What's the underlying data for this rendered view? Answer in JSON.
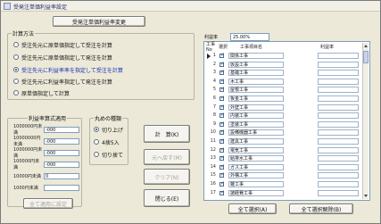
{
  "window": {
    "title": "受発注単価利益率設定"
  },
  "header_button": "受発注単価利益率変更",
  "calc_method": {
    "legend": "計算方法",
    "options": [
      {
        "label": "受注先元に原単価指定して受注を計算",
        "selected": false
      },
      {
        "label": "受注先元に原単価指定して発注を計算",
        "selected": false
      },
      {
        "label": "受注先元に利益率率を指定して受注を計算",
        "selected": true
      },
      {
        "label": "受注先元に利益率指定して発注を計算",
        "selected": false
      },
      {
        "label": "原単価指定して計算",
        "selected": false
      }
    ]
  },
  "rate_group": {
    "legend": "利益率算式適用",
    "rows": [
      {
        "label": "1000000円未満",
        "value": "-000"
      },
      {
        "label": "10000000円未満",
        "value": "-000"
      },
      {
        "label": "1000000円未満",
        "value": "-000"
      },
      {
        "label": "100000円未満",
        "value": "-000"
      },
      {
        "label": "10000円未満",
        "value": "0"
      },
      {
        "label": "1000円未満",
        "value": ""
      }
    ],
    "apply_button": "全て適用に設定"
  },
  "rounding": {
    "legend": "丸めの種類",
    "options": [
      {
        "label": "切り上げ",
        "selected": true
      },
      {
        "label": "4捨5入",
        "selected": false
      },
      {
        "label": "切り捨て",
        "selected": false
      }
    ]
  },
  "buttons": {
    "calc": "計　算(K)",
    "prev": "元へ戻す(M)",
    "clear": "クリア(N)",
    "close": "閉じる(E)",
    "all_select": "全て選択(A)",
    "all_deselect": "全て選択解除(B)"
  },
  "rate_field": {
    "label": "利益率",
    "value": "25.00%"
  },
  "list": {
    "headers": {
      "no": "工事No",
      "check": "選択",
      "name": "工事項目名",
      "rate": "利益率"
    },
    "rows": [
      {
        "no": "1",
        "checked": true,
        "name": "関係工事"
      },
      {
        "no": "2",
        "checked": true,
        "name": "仮設工事"
      },
      {
        "no": "3",
        "checked": true,
        "name": "基礎工事"
      },
      {
        "no": "4",
        "checked": true,
        "name": "木工事"
      },
      {
        "no": "5",
        "checked": true,
        "name": "屋根工事"
      },
      {
        "no": "6",
        "checked": true,
        "name": "板金工事"
      },
      {
        "no": "7",
        "checked": true,
        "name": "外壁工事"
      },
      {
        "no": "8",
        "checked": true,
        "name": "内装工事"
      },
      {
        "no": "9",
        "checked": true,
        "name": "塗装工事"
      },
      {
        "no": "10",
        "checked": true,
        "name": "設備機器工事"
      },
      {
        "no": "11",
        "checked": true,
        "name": "建具工事"
      },
      {
        "no": "12",
        "checked": true,
        "name": "電気工事"
      },
      {
        "no": "13",
        "checked": true,
        "name": "給排水工事"
      },
      {
        "no": "14",
        "checked": true,
        "name": "ガス工事"
      },
      {
        "no": "15",
        "checked": true,
        "name": "外構工事"
      },
      {
        "no": "16",
        "checked": true,
        "name": "雑工事"
      },
      {
        "no": "17",
        "checked": true,
        "name": "諸経費工事"
      }
    ]
  }
}
